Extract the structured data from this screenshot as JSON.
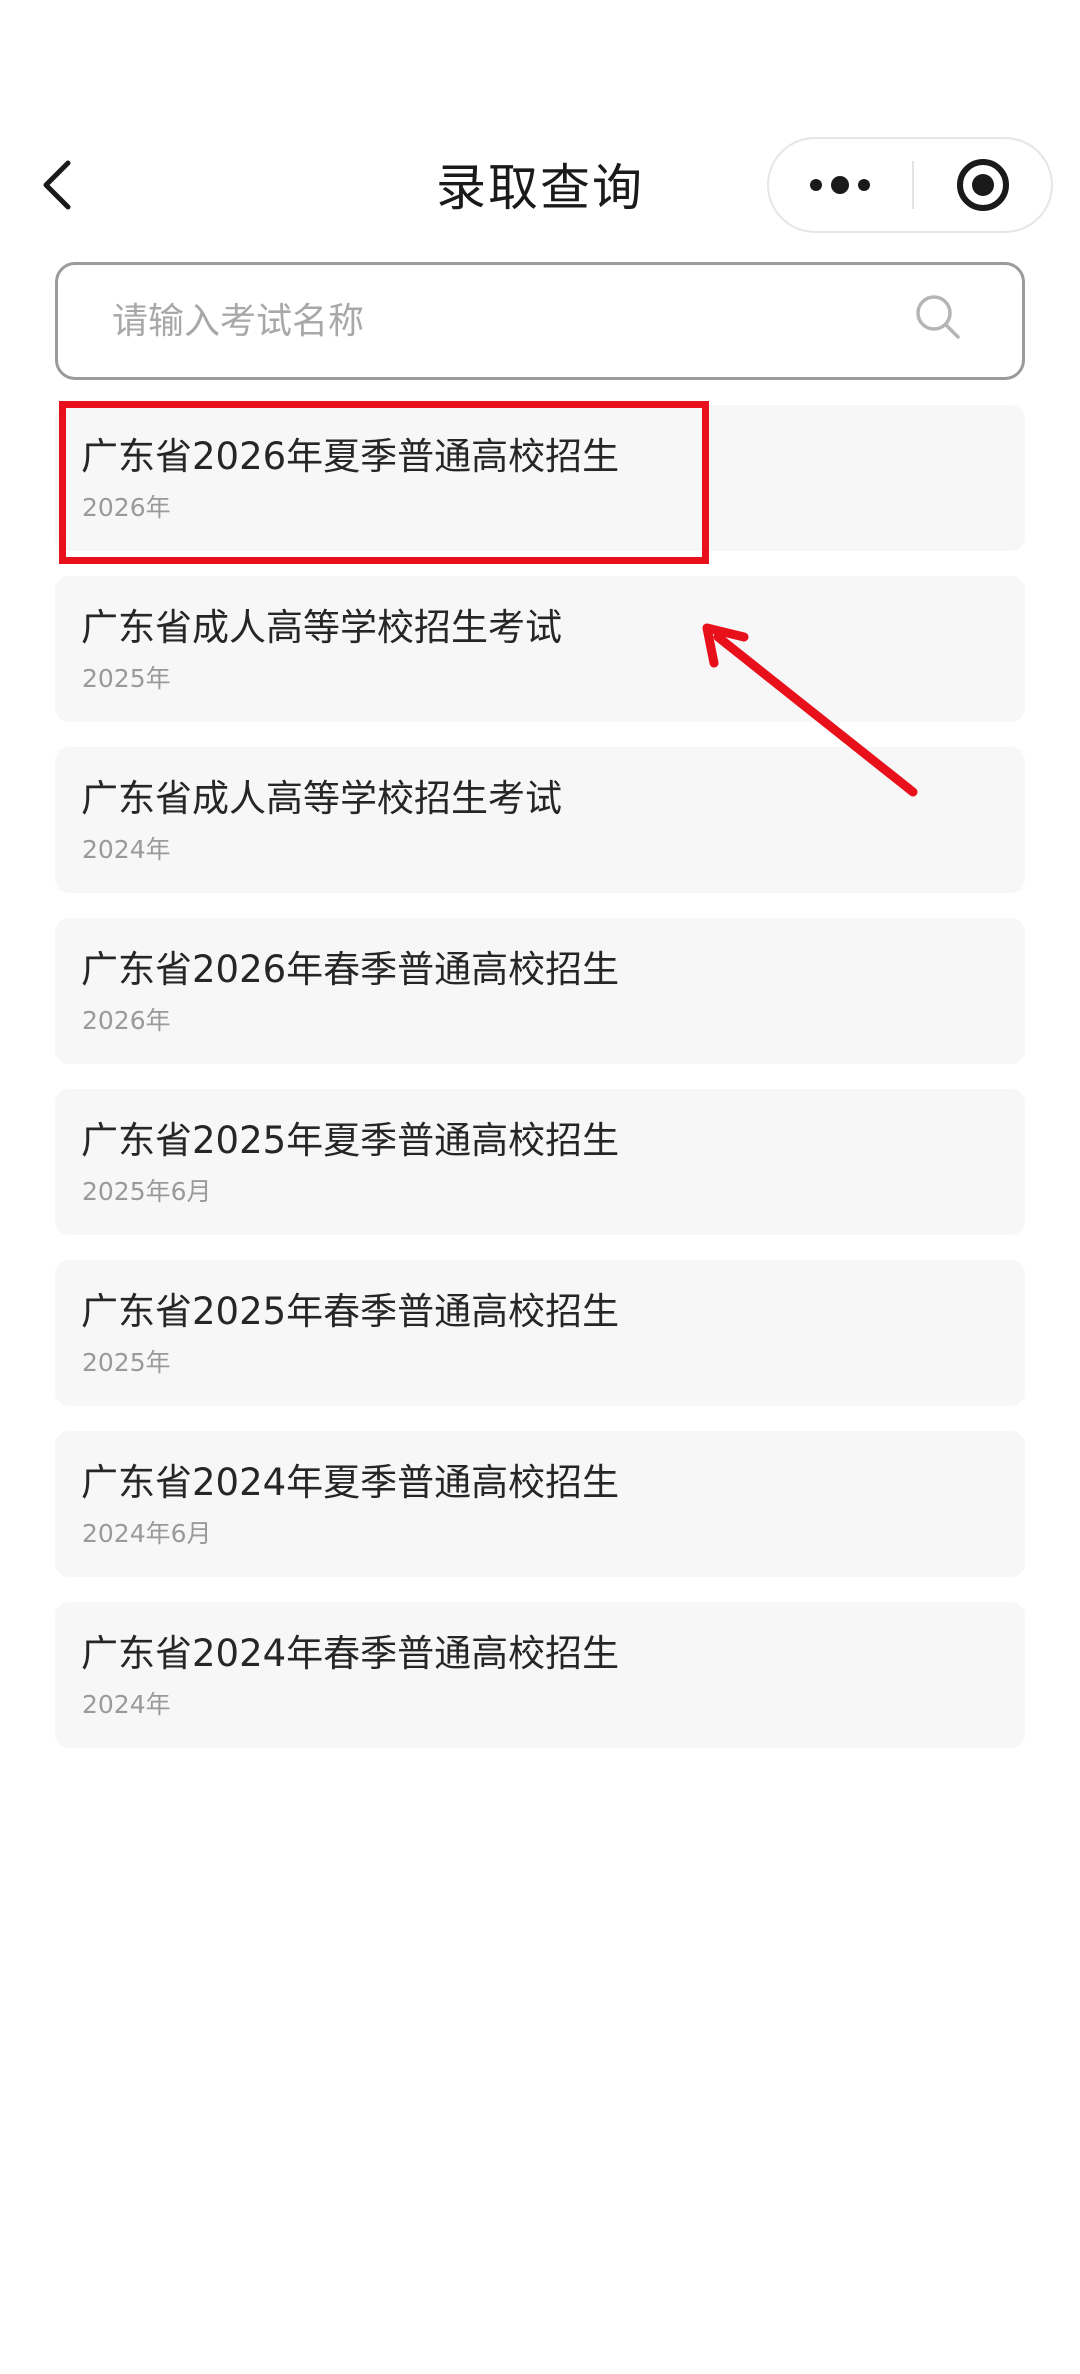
{
  "header": {
    "title": "录取查询",
    "back_icon": "chevron-left-icon",
    "more_icon": "more-dots-icon",
    "target_icon": "target-circle-icon"
  },
  "search": {
    "placeholder": "请输入考试名称",
    "value": "",
    "icon": "search-icon"
  },
  "exams": [
    {
      "title": "广东省2026年夏季普通高校招生",
      "year": "2026年"
    },
    {
      "title": "广东省成人高等学校招生考试",
      "year": "2025年"
    },
    {
      "title": "广东省成人高等学校招生考试",
      "year": "2024年"
    },
    {
      "title": "广东省2026年春季普通高校招生",
      "year": "2026年"
    },
    {
      "title": "广东省2025年夏季普通高校招生",
      "year": "2025年6月"
    },
    {
      "title": "广东省2025年春季普通高校招生",
      "year": "2025年"
    },
    {
      "title": "广东省2024年夏季普通高校招生",
      "year": "2024年6月"
    },
    {
      "title": "广东省2024年春季普通高校招生",
      "year": "2024年"
    }
  ],
  "annotation": {
    "highlight_color": "#e8101a"
  },
  "colors": {
    "card_background": "#f7f7f7",
    "search_border": "#9b9b9b",
    "title_text": "#262626",
    "subtitle_text": "#9a9a9a"
  }
}
